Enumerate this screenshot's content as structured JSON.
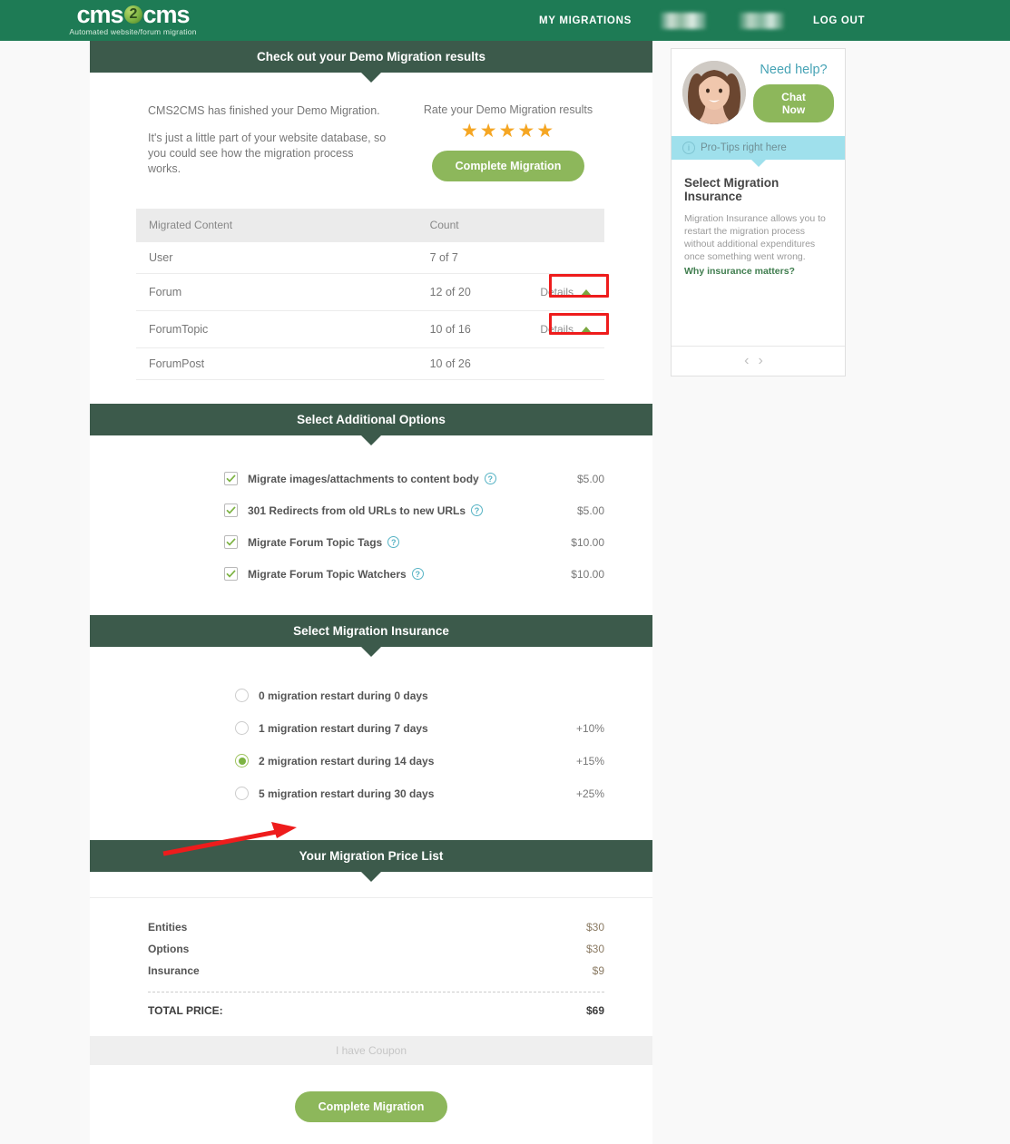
{
  "header": {
    "logo_main_left": "cms",
    "logo_main_right": "cms",
    "logo_ball": "2",
    "logo_tagline": "Automated website/forum migration",
    "nav": [
      {
        "label": "MY MIGRATIONS",
        "blurred": false
      },
      {
        "label": "",
        "blurred": true
      },
      {
        "label": "",
        "blurred": true
      },
      {
        "label": "LOG OUT",
        "blurred": false
      }
    ]
  },
  "results": {
    "section_title": "Check out your Demo Migration results",
    "paragraph1": "CMS2CMS has finished your Demo Migration.",
    "paragraph2": "It's just a little part of your website database, so you could see how the migration process works.",
    "rate_label": "Rate your Demo Migration results",
    "stars": "★★★★★",
    "star_count": 5,
    "complete_button": "Complete Migration",
    "table": {
      "columns": [
        "Migrated Content",
        "Count"
      ],
      "details_label": "Details",
      "rows": [
        {
          "name": "User",
          "count": "7 of 7",
          "details": false,
          "highlighted": false
        },
        {
          "name": "Forum",
          "count": "12 of 20",
          "details": true,
          "highlighted": true
        },
        {
          "name": "ForumTopic",
          "count": "10 of 16",
          "details": true,
          "highlighted": true
        },
        {
          "name": "ForumPost",
          "count": "10 of 26",
          "details": false,
          "highlighted": false
        }
      ]
    }
  },
  "options": {
    "section_title": "Select Additional Options",
    "help_glyph": "?",
    "items": [
      {
        "label": "Migrate images/attachments to content body",
        "price": "$5.00",
        "checked": true
      },
      {
        "label": "301 Redirects from old URLs to new URLs",
        "price": "$5.00",
        "checked": true
      },
      {
        "label": "Migrate Forum Topic Tags",
        "price": "$10.00",
        "checked": true
      },
      {
        "label": "Migrate Forum Topic Watchers",
        "price": "$10.00",
        "checked": true
      }
    ]
  },
  "insurance": {
    "section_title": "Select Migration Insurance",
    "items": [
      {
        "label": "0 migration restart during 0 days",
        "price": "",
        "selected": false
      },
      {
        "label": "1 migration restart during 7 days",
        "price": "+10%",
        "selected": false
      },
      {
        "label": "2 migration restart during 14 days",
        "price": "+15%",
        "selected": true
      },
      {
        "label": "5 migration restart during 30 days",
        "price": "+25%",
        "selected": false
      }
    ]
  },
  "price_list": {
    "section_title": "Your Migration Price List",
    "rows": [
      {
        "label": "Entities",
        "value": "$30"
      },
      {
        "label": "Options",
        "value": "$30"
      },
      {
        "label": "Insurance",
        "value": "$9"
      }
    ],
    "total_label": "TOTAL PRICE:",
    "total_value": "$69",
    "coupon_label": "I have Coupon",
    "complete_button": "Complete Migration"
  },
  "sidebar": {
    "need_help": "Need help?",
    "chat_button": "Chat Now",
    "protip_label": "Pro-Tips right here",
    "info_glyph": "i",
    "tip_title": "Select Migration Insurance",
    "tip_text": "Migration Insurance allows you to restart the migration process without additional expenditures once something went wrong.",
    "tip_link": "Why insurance matters?",
    "prev_glyph": "‹",
    "next_glyph": "›"
  },
  "colors": {
    "brand_green": "#1e7b55",
    "section_dark": "#3c5a4b",
    "button_green": "#8db75b",
    "star_amber": "#f5a623",
    "annotation_red": "#ee1c1c",
    "protip_cyan": "#9fe0ec",
    "link_green": "#3f7d4e"
  }
}
